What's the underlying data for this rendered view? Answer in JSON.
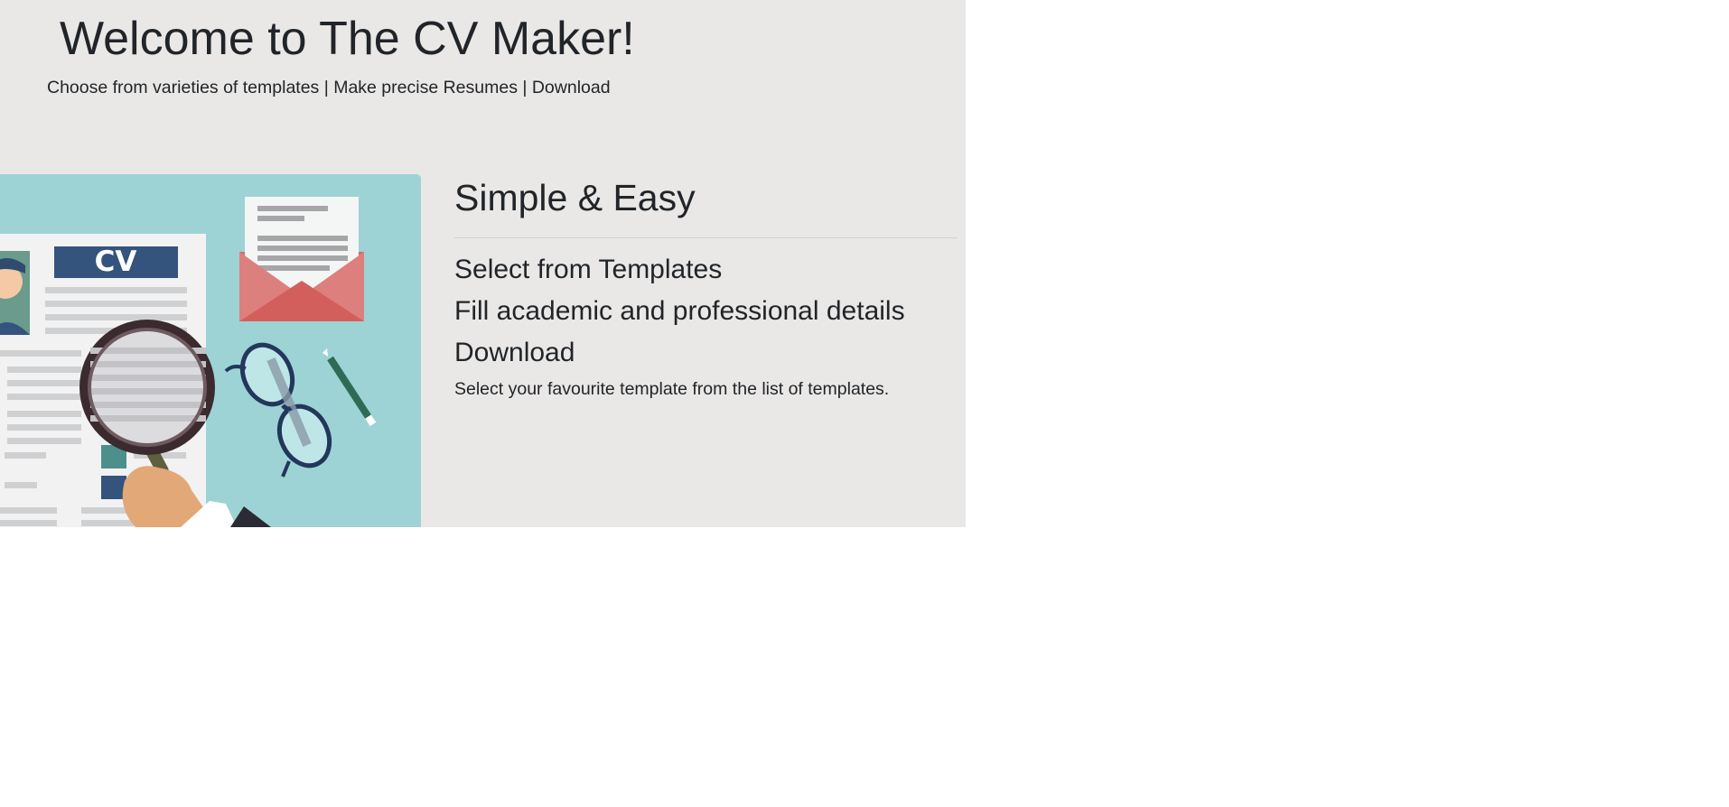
{
  "hero": {
    "title": "Welcome to The CV Maker!",
    "subtitle": "Choose from varieties of templates | Make precise Resumes | Download"
  },
  "illustration": {
    "cv_label": "CV",
    "icons": [
      "cv-document-icon",
      "magnifying-glass-icon",
      "envelope-icon",
      "glasses-icon",
      "pen-icon"
    ],
    "background_color": "#9dd3d5"
  },
  "features": {
    "heading": "Simple & Easy",
    "steps": [
      "Select from Templates",
      "Fill academic and professional details",
      "Download"
    ],
    "description": "Select your favourite template from the list of templates."
  },
  "colors": {
    "hero_background": "#eae8e6",
    "page_background": "#ffffff",
    "text": "#212529"
  }
}
